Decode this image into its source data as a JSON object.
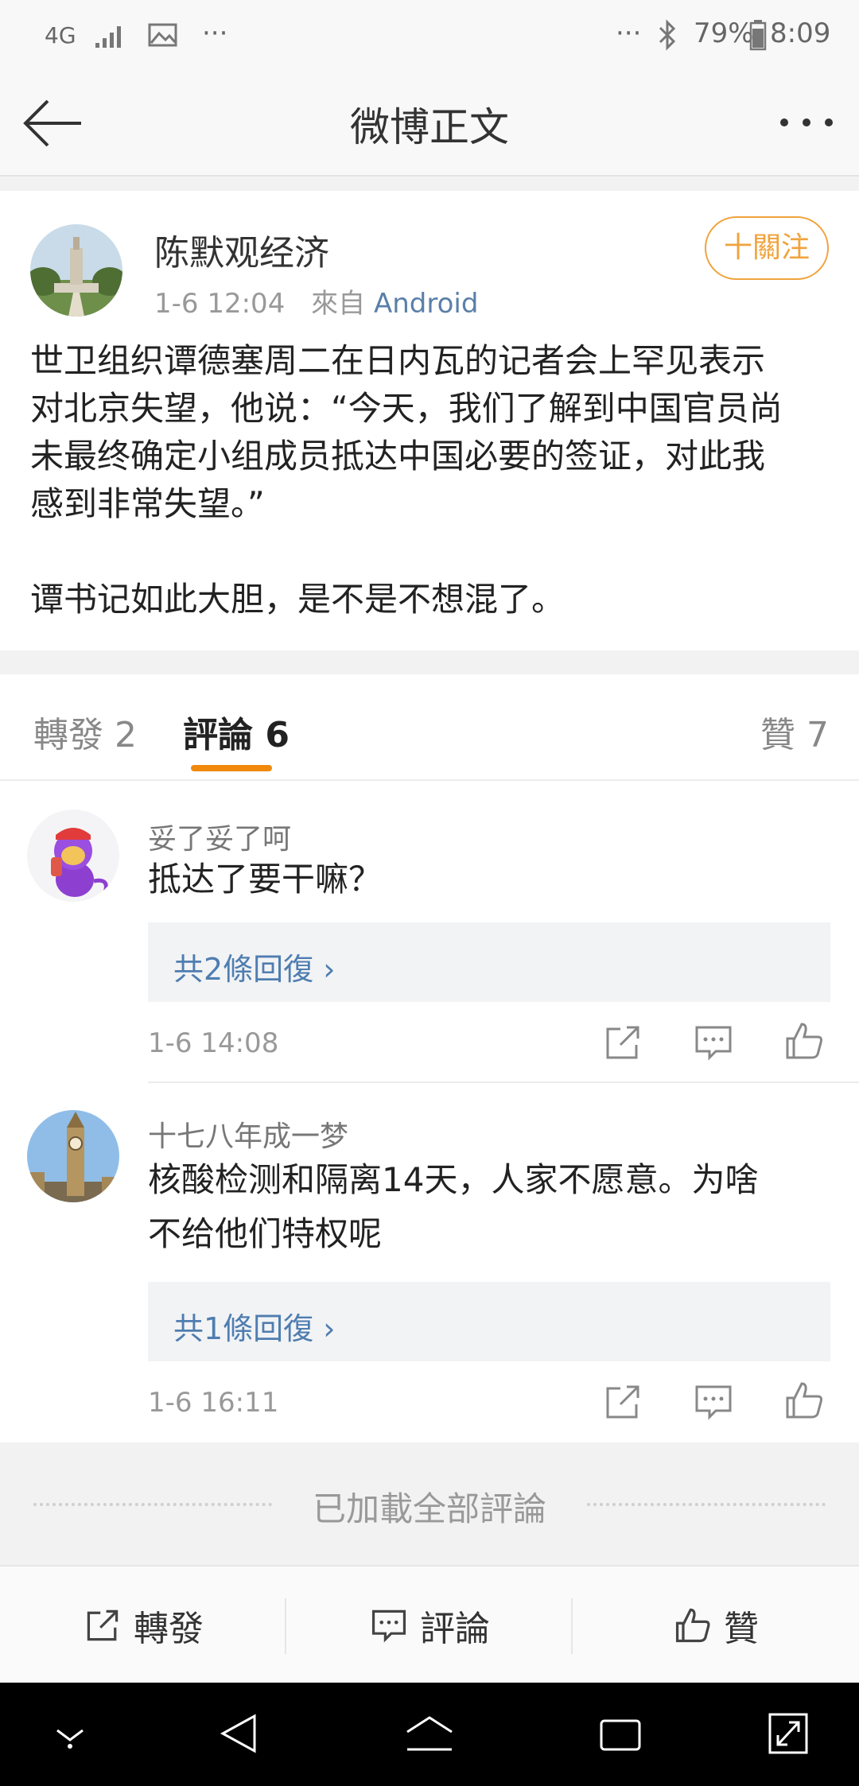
{
  "status_bar": {
    "network": "4G",
    "more_left": "···",
    "more_right": "···",
    "battery": "79%",
    "time": "8:09",
    "icons": [
      "signal-icon",
      "image-icon",
      "bluetooth-icon",
      "battery-icon"
    ]
  },
  "header": {
    "title": "微博正文",
    "back_icon": "back-arrow-icon",
    "more_icon": "more-dots-icon"
  },
  "post": {
    "author": "陈默观经济",
    "time": "1-6 12:04",
    "source_prefix": "來自",
    "source": "Android",
    "follow_label": "十關注",
    "paragraph1_line1": "世卫组织谭德塞周二在日内瓦的记者会上罕见表示",
    "paragraph1_line2": "对北京失望，他说：“今天，我们了解到中国官员尚",
    "paragraph1_line3": "未最终确定小组成员抵达中国必要的签证，对此我",
    "paragraph1_line4": "感到非常失望。”",
    "paragraph2": "谭书记如此大胆，是不是不想混了。"
  },
  "tabs": {
    "repost": "轉發 2",
    "comments": "評論 6",
    "likes": "贊 7"
  },
  "comments": [
    {
      "name": "妥了妥了呵",
      "text_line1": "抵达了要干嘛？",
      "replies": "共2條回復 ›",
      "time": "1-6 14:08"
    },
    {
      "name": "十七八年成一梦",
      "text_line1": "核酸检测和隔离14天，人家不愿意。为啥",
      "text_line2": "不给他们特权呢",
      "replies": "共1條回復 ›",
      "time": "1-6 16:11"
    }
  ],
  "loaded_all": "已加載全部評論",
  "action_bar": {
    "repost": "轉發",
    "comment": "評論",
    "like": "贊"
  },
  "colors": {
    "accent_orange": "#f0a33c",
    "tab_underline": "#f0890c",
    "link_blue": "#4f7db0"
  }
}
